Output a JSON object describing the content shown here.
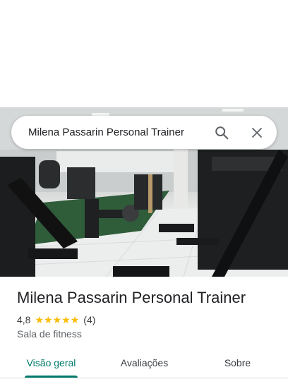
{
  "search": {
    "query": "Milena Passarin Personal Trainer",
    "search_icon": "search-icon",
    "close_icon": "close-icon"
  },
  "place": {
    "name": "Milena Passarin Personal Trainer",
    "rating": "4,8",
    "stars": 5,
    "review_count": "(4)",
    "category": "Sala de fitness"
  },
  "tabs": [
    {
      "label": "Visão geral",
      "active": true
    },
    {
      "label": "Avaliações",
      "active": false
    },
    {
      "label": "Sobre",
      "active": false
    }
  ],
  "colors": {
    "accent": "#00796b",
    "star": "#fbbc04"
  }
}
